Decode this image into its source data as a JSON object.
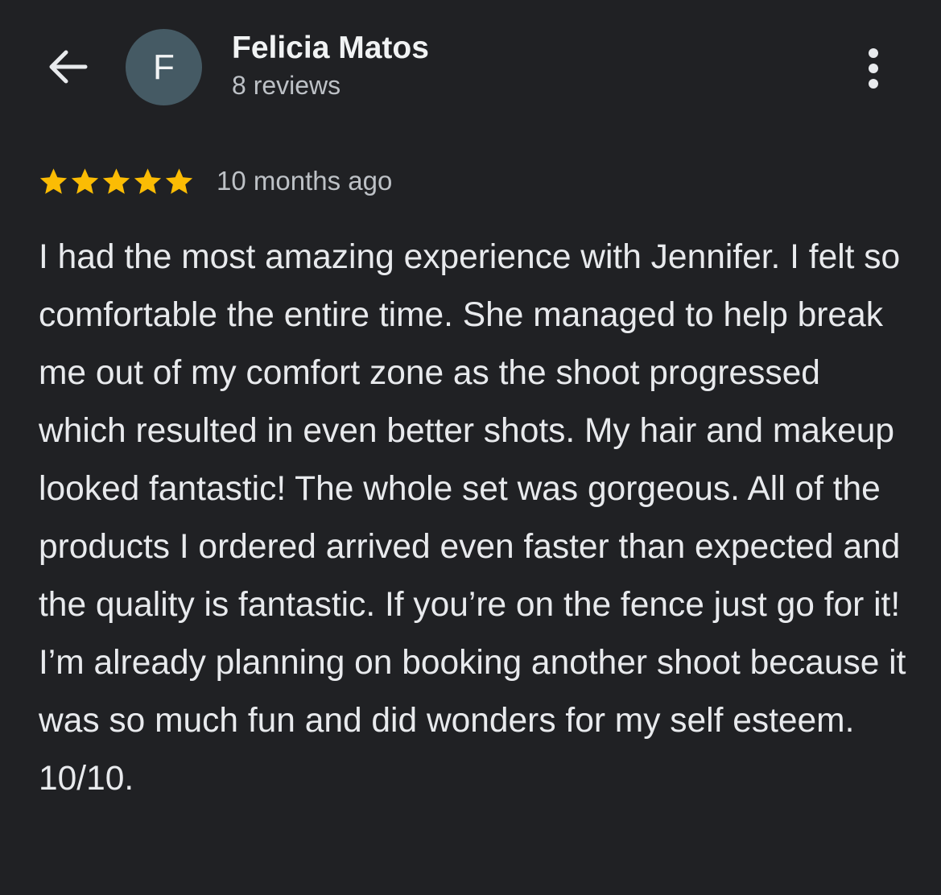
{
  "reviewer": {
    "avatar_letter": "F",
    "avatar_color": "#455a64",
    "name": "Felicia Matos",
    "review_count": "8 reviews"
  },
  "icons": {
    "back": "arrow-left-icon",
    "menu": "more-vertical-icon",
    "star": "star-icon"
  },
  "review": {
    "rating": 5,
    "rating_max": 5,
    "star_color": "#fbbc04",
    "time_ago": "10 months ago",
    "text": "I had the most amazing experience with Jennifer. I felt so comfortable the entire time. She managed to help break me out of my comfort zone as the shoot progressed which resulted in even better shots. My hair and makeup looked fantastic! The whole set was gorgeous. All of the products I ordered arrived even faster than expected and the quality is fantastic. If you’re on the fence just go for it! I’m already planning on booking another shoot because it was so much fun and did wonders for my self esteem. 10/10."
  }
}
